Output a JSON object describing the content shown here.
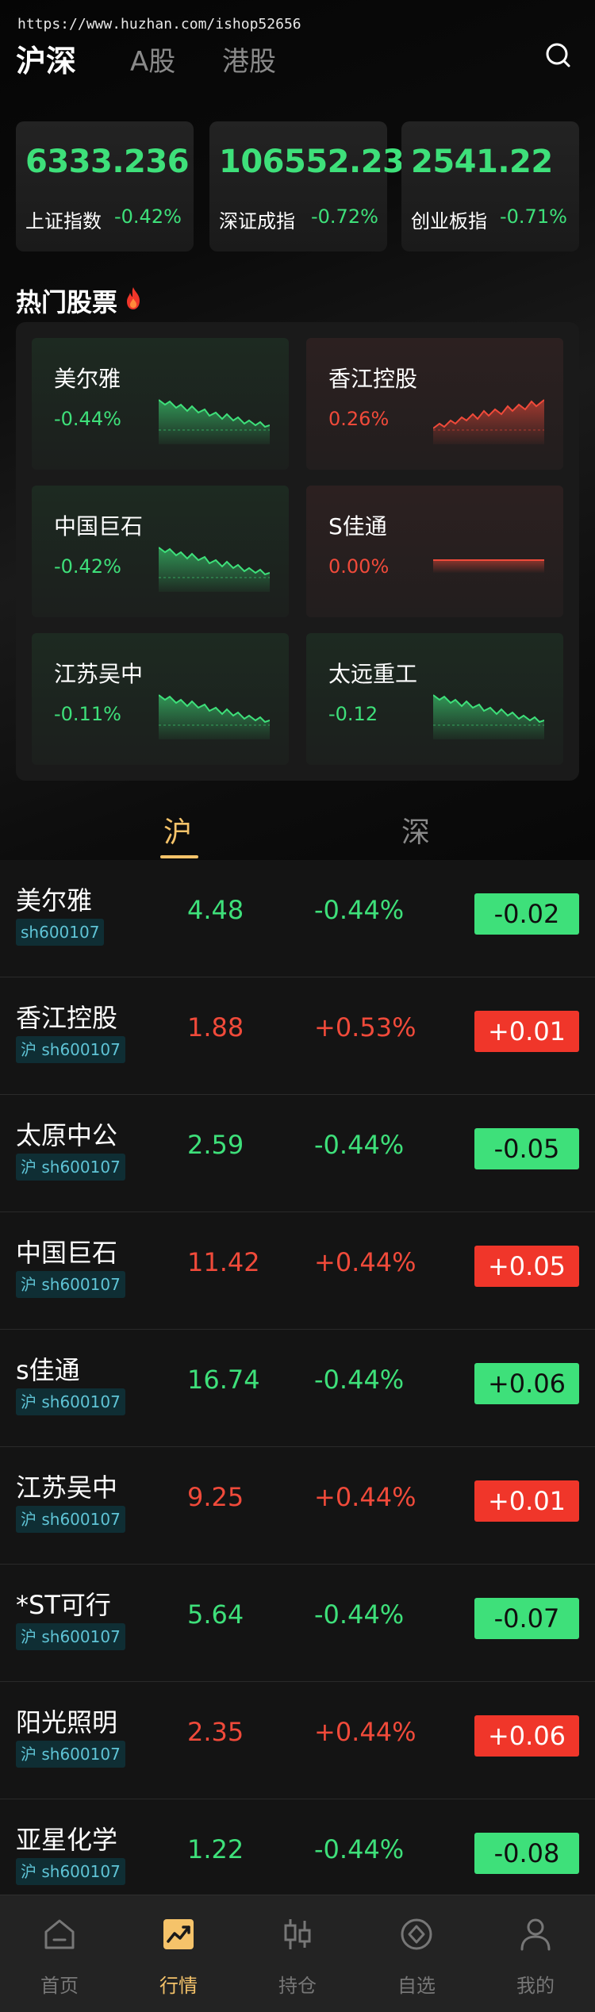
{
  "watermark": "https://www.huzhan.com/ishop52656",
  "top_tabs": [
    "沪深",
    "A股",
    "港股"
  ],
  "indices": [
    {
      "value": "6333.236",
      "name": "上证指数",
      "change": "-0.42%"
    },
    {
      "value": "106552.23",
      "name": "深证成指",
      "change": "-0.72%"
    },
    {
      "value": "2541.22",
      "name": "创业板指",
      "change": "-0.71%"
    }
  ],
  "hot_title": "热门股票",
  "hot_stocks": [
    {
      "name": "美尔雅",
      "change": "-0.44%",
      "trend": "down"
    },
    {
      "name": "香江控股",
      "change": "0.26%",
      "trend": "up"
    },
    {
      "name": "中国巨石",
      "change": "-0.42%",
      "trend": "down"
    },
    {
      "name": "S佳通",
      "change": "0.00%",
      "trend": "flat"
    },
    {
      "name": "江苏吴中",
      "change": "-0.11%",
      "trend": "down"
    },
    {
      "name": "太远重工",
      "change": "-0.12",
      "trend": "down"
    }
  ],
  "market_tabs": [
    "沪",
    "深"
  ],
  "stocks": [
    {
      "name": "美尔雅",
      "code": "sh600107",
      "price": "4.48",
      "pct": "-0.44%",
      "chg": "-0.02",
      "dir": "down"
    },
    {
      "name": "香江控股",
      "code": "沪 sh600107",
      "price": "1.88",
      "pct": "+0.53%",
      "chg": "+0.01",
      "dir": "up"
    },
    {
      "name": "太原中公",
      "code": "沪 sh600107",
      "price": "2.59",
      "pct": "-0.44%",
      "chg": "-0.05",
      "dir": "down"
    },
    {
      "name": "中国巨石",
      "code": "沪 sh600107",
      "price": "11.42",
      "pct": "+0.44%",
      "chg": "+0.05",
      "dir": "up"
    },
    {
      "name": "s佳通",
      "code": "沪 sh600107",
      "price": "16.74",
      "pct": "-0.44%",
      "chg": "+0.06",
      "dir": "down"
    },
    {
      "name": "江苏吴中",
      "code": "沪 sh600107",
      "price": "9.25",
      "pct": "+0.44%",
      "chg": "+0.01",
      "dir": "up"
    },
    {
      "name": "*ST可行",
      "code": "沪 sh600107",
      "price": "5.64",
      "pct": "-0.44%",
      "chg": "-0.07",
      "dir": "down"
    },
    {
      "name": "阳光照明",
      "code": "沪 sh600107",
      "price": "2.35",
      "pct": "+0.44%",
      "chg": "+0.06",
      "dir": "up"
    },
    {
      "name": "亚星化学",
      "code": "沪 sh600107",
      "price": "1.22",
      "pct": "-0.44%",
      "chg": "-0.08",
      "dir": "down"
    }
  ],
  "nav": [
    {
      "label": "首页",
      "icon": "home-icon"
    },
    {
      "label": "行情",
      "icon": "chart-icon"
    },
    {
      "label": "持仓",
      "icon": "candlestick-icon"
    },
    {
      "label": "自选",
      "icon": "favorite-icon"
    },
    {
      "label": "我的",
      "icon": "user-icon"
    }
  ],
  "colors": {
    "up": "#f04a3a",
    "down": "#3ee07a",
    "accent": "#f5c36a"
  }
}
